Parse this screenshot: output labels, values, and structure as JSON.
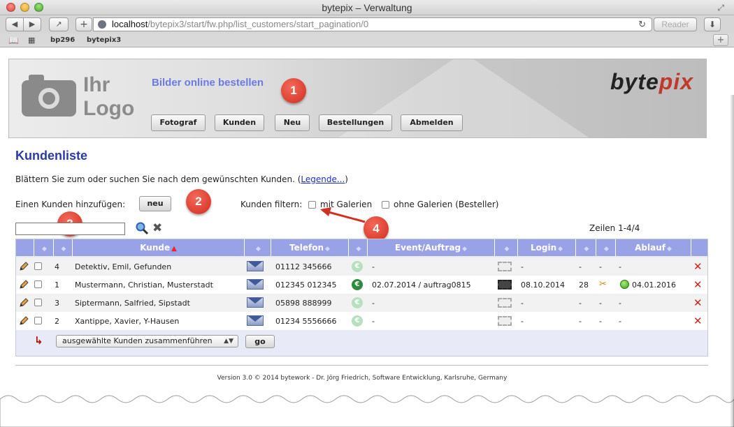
{
  "window": {
    "title": "bytepix – Verwaltung"
  },
  "toolbar": {
    "url_host": "localhost",
    "url_path": "/bytepix3/start/fw.php/list_customers/start_pagination/0",
    "reader_label": "Reader"
  },
  "bookmarks": [
    {
      "label": "bp296"
    },
    {
      "label": "bytepix3"
    }
  ],
  "header": {
    "logo_line1": "Ihr",
    "logo_line2": "Logo",
    "slogan": "Bilder online bestellen",
    "brand_a": "byte",
    "brand_b": "pix",
    "nav": [
      "Fotograf",
      "Kunden",
      "Neu",
      "Bestellungen",
      "Abmelden"
    ]
  },
  "badges": [
    "1",
    "2",
    "3",
    "4"
  ],
  "main": {
    "title": "Kundenliste",
    "intro": "Blättern Sie zum oder suchen Sie nach dem gewünschten Kunden. (",
    "legend_link": "Legende...",
    "intro_end": ")",
    "add_label": "Einen Kunden hinzufügen:",
    "new_button": "neu",
    "filter_label": "Kunden filtern:",
    "filter_with": "mit Galerien",
    "filter_without": "ohne Galerien (Besteller)",
    "search_placeholder": "",
    "rows_info": "Zeilen 1-4/4"
  },
  "table": {
    "columns": [
      "",
      "",
      "Kunde",
      "",
      "Telefon",
      "",
      "Event/Auftrag",
      "",
      "Login",
      "",
      "",
      "Ablauf",
      ""
    ],
    "rows": [
      {
        "id": "4",
        "name": "Detektiv, Emil, Gefunden",
        "phone": "01112 345666",
        "paid": false,
        "event": "-",
        "film": false,
        "login": "-",
        "count": "-",
        "tool": "-",
        "expiry": "-",
        "active": false
      },
      {
        "id": "1",
        "name": "Mustermann, Christian, Musterstadt",
        "phone": "012345 012345",
        "paid": true,
        "event": "02.07.2014 / auftrag0815",
        "film": true,
        "login": "08.10.2014",
        "count": "28",
        "tool": "",
        "expiry": "04.01.2016",
        "active": true
      },
      {
        "id": "3",
        "name": "Siptermann, Salfried, Sipstadt",
        "phone": "05898 888999",
        "paid": false,
        "event": "-",
        "film": false,
        "login": "-",
        "count": "-",
        "tool": "-",
        "expiry": "-",
        "active": false
      },
      {
        "id": "2",
        "name": "Xantippe, Xavier, Y-Hausen",
        "phone": "01234 5556666",
        "paid": false,
        "event": "-",
        "film": false,
        "login": "-",
        "count": "-",
        "tool": "-",
        "expiry": "-",
        "active": false
      }
    ],
    "merge_option": "ausgewählte Kunden zusammenführen",
    "go_button": "go"
  },
  "footer": {
    "text": "Version 3.0 © 2014 bytework - Dr. Jörg Friedrich, Software Entwicklung, Karlsruhe, Germany"
  },
  "colors": {
    "accent_blue": "#2a3aa8",
    "header_row": "#99a2e6",
    "badge_red": "#d12c1d"
  }
}
